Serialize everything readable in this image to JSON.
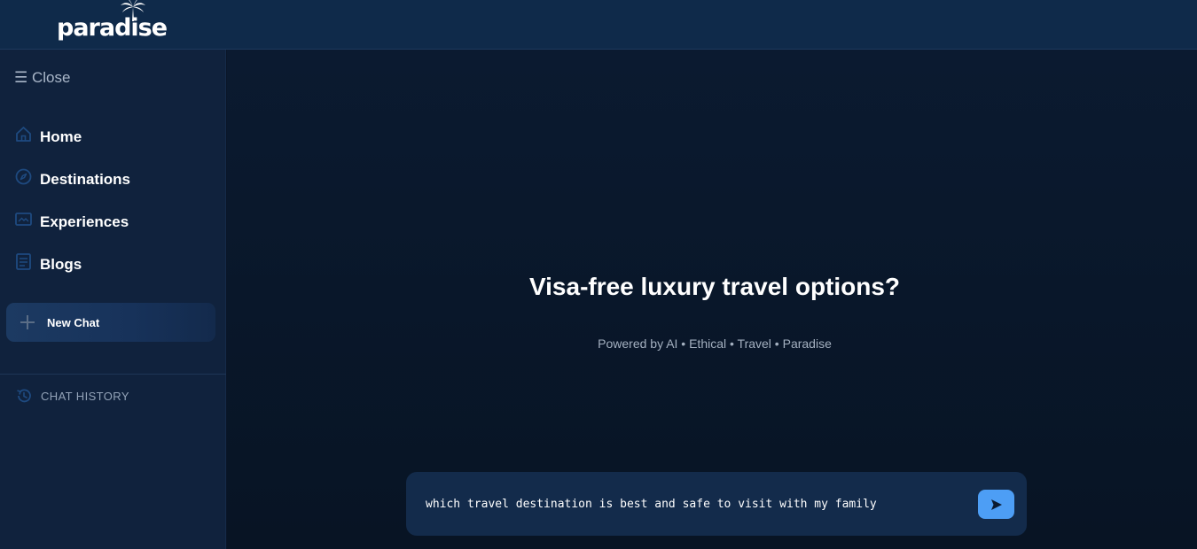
{
  "brand": {
    "logo_text": "paradise"
  },
  "sidebar": {
    "close_label": "☰ Close",
    "nav": [
      {
        "label": "Home",
        "icon": "home-icon"
      },
      {
        "label": "Destinations",
        "icon": "compass-icon"
      },
      {
        "label": "Experiences",
        "icon": "gallery-icon"
      },
      {
        "label": "Blogs",
        "icon": "book-icon"
      }
    ],
    "new_chat_label": "New Chat",
    "history_label": "CHAT HISTORY"
  },
  "main": {
    "headline": "Visa-free luxury travel options?",
    "subline": "Powered by AI • Ethical • Travel • Paradise",
    "input_value": "which travel destination is best and safe to visit with my family"
  },
  "colors": {
    "header_bg": "#0f2a4a",
    "sidebar_bg": "#10223d",
    "main_bg": "#0a1628",
    "accent": "#4d9ef5",
    "icon_muted": "#1e4a80"
  }
}
